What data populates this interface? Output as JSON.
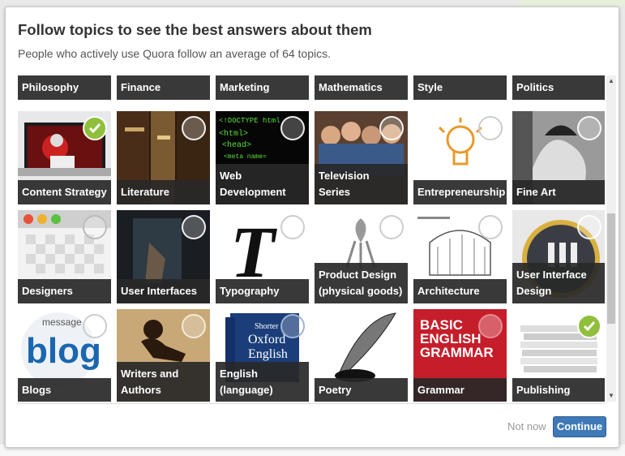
{
  "modal": {
    "title": "Follow topics to see the best answers about them",
    "subtitle": "People who actively use Quora follow an average of 64 topics.",
    "not_now_label": "Not now",
    "continue_label": "Continue"
  },
  "top_row": [
    {
      "label": "Philosophy"
    },
    {
      "label": "Finance"
    },
    {
      "label": "Marketing"
    },
    {
      "label": "Mathematics"
    },
    {
      "label": "Style"
    },
    {
      "label": "Politics"
    }
  ],
  "topics": [
    {
      "label": "Content Strategy",
      "selected": true,
      "icon": "tv-sports-image"
    },
    {
      "label": "Literature",
      "selected": false,
      "icon": "books-image"
    },
    {
      "label": "Web Development",
      "selected": false,
      "icon": "html-code-image"
    },
    {
      "label": "Television Series",
      "selected": false,
      "icon": "tv-cast-image"
    },
    {
      "label": "Entrepreneurship",
      "selected": false,
      "icon": "lightbulb-image"
    },
    {
      "label": "Fine Art",
      "selected": false,
      "icon": "art-figure-image"
    },
    {
      "label": "Designers",
      "selected": false,
      "icon": "mac-window-image"
    },
    {
      "label": "User Interfaces",
      "selected": false,
      "icon": "touchscreen-image"
    },
    {
      "label": "Typography",
      "selected": false,
      "icon": "letter-t-image"
    },
    {
      "label": "Product Design (physical goods)",
      "selected": false,
      "icon": "juicer-image"
    },
    {
      "label": "Architecture",
      "selected": false,
      "icon": "building-sketch-image"
    },
    {
      "label": "User Interface Design",
      "selected": false,
      "icon": "pause-button-image"
    },
    {
      "label": "Blogs",
      "selected": false,
      "icon": "blog-wordcloud-image"
    },
    {
      "label": "Writers and Authors",
      "selected": false,
      "icon": "writer-silhouette-image"
    },
    {
      "label": "English (language)",
      "selected": false,
      "icon": "oxford-dictionary-image"
    },
    {
      "label": "Poetry",
      "selected": false,
      "icon": "quill-ink-image"
    },
    {
      "label": "Grammar",
      "selected": false,
      "icon": "grammar-book-image"
    },
    {
      "label": "Publishing",
      "selected": true,
      "icon": "paper-stack-image"
    }
  ],
  "colors": {
    "primary_button": "#3f79b7",
    "check_selected": "#8fbf3c"
  },
  "scroll_icons": {
    "up": "▲",
    "down": "▼"
  }
}
